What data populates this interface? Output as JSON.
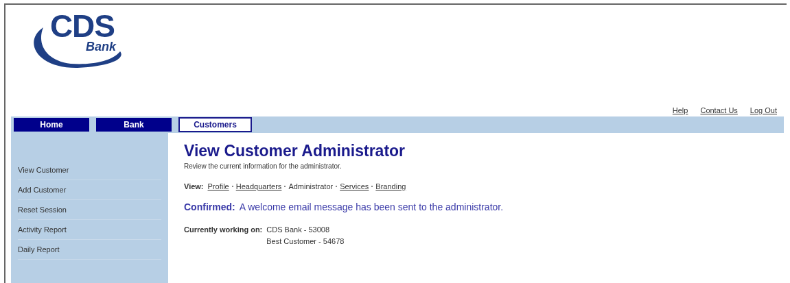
{
  "logo": {
    "main": "CDS",
    "sub": "Bank"
  },
  "utility_links": [
    "Help",
    "Contact Us",
    "Log Out"
  ],
  "tabs": [
    {
      "label": "Home",
      "selected": false
    },
    {
      "label": "Bank",
      "selected": false
    },
    {
      "label": "Customers",
      "selected": true
    }
  ],
  "sidebar": {
    "items": [
      "View Customer",
      "Add Customer",
      "Reset Session",
      "Activity Report",
      "Daily Report"
    ]
  },
  "page": {
    "title": "View Customer Administrator",
    "subtitle": "Review the current information for the administrator.",
    "view_label": "View:",
    "views": [
      {
        "label": "Profile",
        "selected": false
      },
      {
        "label": "Headquarters",
        "selected": false
      },
      {
        "label": "Administrator",
        "selected": true
      },
      {
        "label": "Services",
        "selected": false
      },
      {
        "label": "Branding",
        "selected": false
      }
    ],
    "confirmation": {
      "label": "Confirmed:",
      "message": "A welcome email message has been sent to the administrator."
    },
    "working_on": {
      "label": "Currently working on:",
      "lines": [
        "CDS Bank - 53008",
        "Best Customer - 54678"
      ]
    }
  }
}
